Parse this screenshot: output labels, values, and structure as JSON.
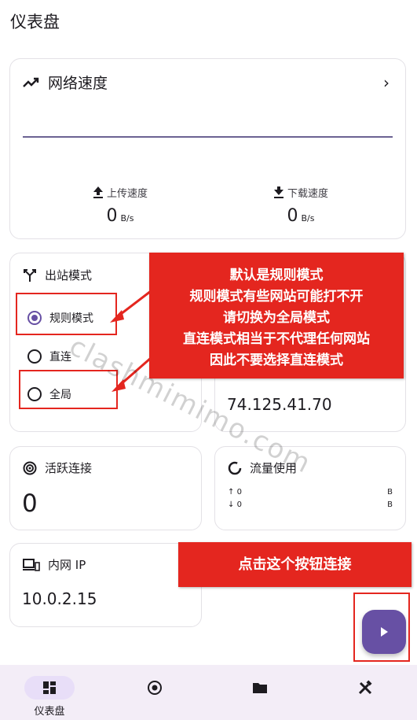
{
  "app": {
    "title": "仪表盘"
  },
  "speed": {
    "title": "网络速度",
    "upload_label": "上传速度",
    "upload_value": "0",
    "upload_unit": "B/s",
    "download_label": "下载速度",
    "download_value": "0",
    "download_unit": "B/s"
  },
  "mode": {
    "title": "出站模式",
    "options": [
      "规则模式",
      "直连",
      "全局"
    ],
    "selected": "规则模式"
  },
  "ip": {
    "value": "74.125.41.70"
  },
  "active": {
    "title": "活跃连接",
    "value": "0"
  },
  "traffic": {
    "title": "流量使用",
    "up_value": "0",
    "up_unit": "B",
    "down_value": "0",
    "down_unit": "B"
  },
  "lanip": {
    "title": "内网 IP",
    "value": "10.0.2.15"
  },
  "nav": {
    "items": [
      "仪表盘"
    ]
  },
  "annotations": {
    "callout1": [
      "默认是规则模式",
      "规则模式有些网站可能打不开",
      "请切换为全局模式",
      "直连模式相当于不代理任何网站",
      "因此不要选择直连模式"
    ],
    "callout2": "点击这个按钮连接",
    "watermark": "clashmimimo.com"
  },
  "colors": {
    "accent": "#6750a4",
    "callout": "#e4261f",
    "navbar": "#f3edf7"
  }
}
